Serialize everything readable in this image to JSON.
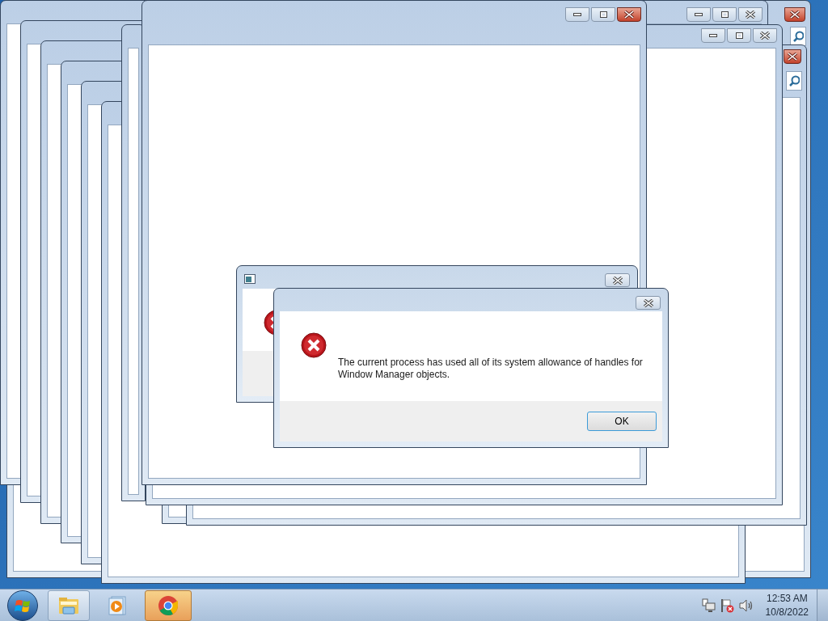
{
  "windows": [
    {
      "kind": "search",
      "active": true
    },
    {
      "kind": "plain",
      "active": false
    },
    {
      "kind": "search",
      "active": true
    },
    {
      "kind": "plain",
      "active": false
    },
    {
      "kind": "plain",
      "active": true
    }
  ],
  "dialogs": [
    {
      "kind": "covered"
    },
    {
      "kind": "message",
      "message": "The current process has used all of its system allowance of handles for Window Manager objects.",
      "buttons": [
        "OK"
      ]
    }
  ],
  "taskbar": {
    "items": [
      {
        "kind": "explorer",
        "selected": false
      },
      {
        "kind": "media",
        "selected": false
      },
      {
        "kind": "chrome",
        "selected": true
      }
    ]
  },
  "tray": {
    "icons": [
      {
        "kind": "network"
      },
      {
        "kind": "flag"
      },
      {
        "kind": "speaker"
      }
    ],
    "time": "12:53 AM",
    "date": "10/8/2022"
  }
}
